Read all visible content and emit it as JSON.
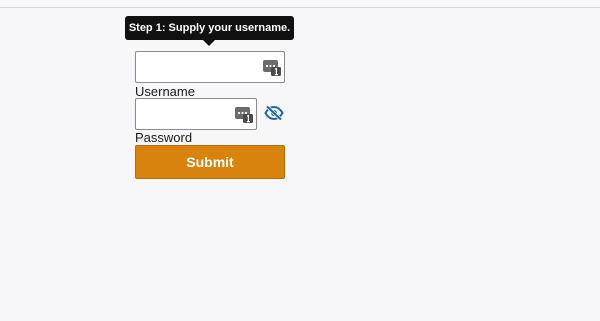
{
  "tooltip": {
    "text": "Step 1: Supply your username."
  },
  "form": {
    "username": {
      "label": "Username",
      "value": ""
    },
    "password": {
      "label": "Password",
      "value": ""
    },
    "submit_label": "Submit"
  },
  "icons": {
    "password_manager": "password-manager-key-icon",
    "reveal_password": "eye-slash-icon"
  },
  "colors": {
    "background": "#f7f6f9",
    "tooltip_bg": "#111111",
    "submit_bg": "#d9830f",
    "reveal_icon": "#1a6a9c"
  }
}
